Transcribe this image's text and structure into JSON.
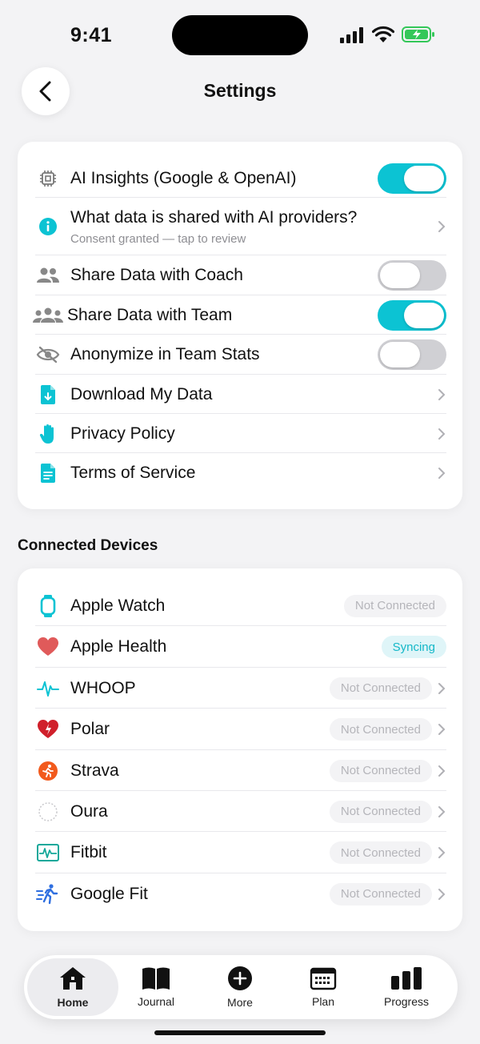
{
  "status": {
    "time": "9:41"
  },
  "header": {
    "title": "Settings"
  },
  "privacy": {
    "items": [
      {
        "label": "AI Insights (Google & OpenAI)",
        "icon": "chip-icon",
        "control": "toggle",
        "on": true
      },
      {
        "label": "What data is shared with AI providers?",
        "sub": "Consent granted — tap to review",
        "icon": "info-icon",
        "control": "chevron"
      },
      {
        "label": "Share Data with Coach",
        "icon": "two-people-icon",
        "control": "toggle",
        "on": false
      },
      {
        "label": "Share Data with Team",
        "icon": "group-icon",
        "control": "toggle",
        "on": true
      },
      {
        "label": "Anonymize in Team Stats",
        "icon": "eye-slash-icon",
        "control": "toggle",
        "on": false
      },
      {
        "label": "Download My Data",
        "icon": "download-doc-icon",
        "control": "chevron"
      },
      {
        "label": "Privacy Policy",
        "icon": "hand-icon",
        "control": "chevron"
      },
      {
        "label": "Terms of Service",
        "icon": "document-icon",
        "control": "chevron"
      }
    ]
  },
  "devices": {
    "title": "Connected Devices",
    "items": [
      {
        "label": "Apple Watch",
        "status": "Not Connected",
        "icon": "watch-icon",
        "chevron": false
      },
      {
        "label": "Apple Health",
        "status": "Syncing",
        "icon": "heart-icon",
        "chevron": false
      },
      {
        "label": "WHOOP",
        "status": "Not Connected",
        "icon": "pulse-icon",
        "chevron": true
      },
      {
        "label": "Polar",
        "status": "Not Connected",
        "icon": "polar-heart-icon",
        "chevron": true
      },
      {
        "label": "Strava",
        "status": "Not Connected",
        "icon": "strava-icon",
        "chevron": true
      },
      {
        "label": "Oura",
        "status": "Not Connected",
        "icon": "ring-icon",
        "chevron": true
      },
      {
        "label": "Fitbit",
        "status": "Not Connected",
        "icon": "fitbit-icon",
        "chevron": true
      },
      {
        "label": "Google Fit",
        "status": "Not Connected",
        "icon": "runner-icon",
        "chevron": true
      }
    ]
  },
  "tabs": [
    {
      "label": "Home",
      "icon": "home-icon",
      "active": true
    },
    {
      "label": "Journal",
      "icon": "book-icon"
    },
    {
      "label": "More",
      "icon": "plus-circle-icon"
    },
    {
      "label": "Plan",
      "icon": "calendar-icon"
    },
    {
      "label": "Progress",
      "icon": "bar-chart-icon"
    }
  ],
  "colors": {
    "accent": "#0cc3d3",
    "toggle_off": "#d0d0d4"
  }
}
